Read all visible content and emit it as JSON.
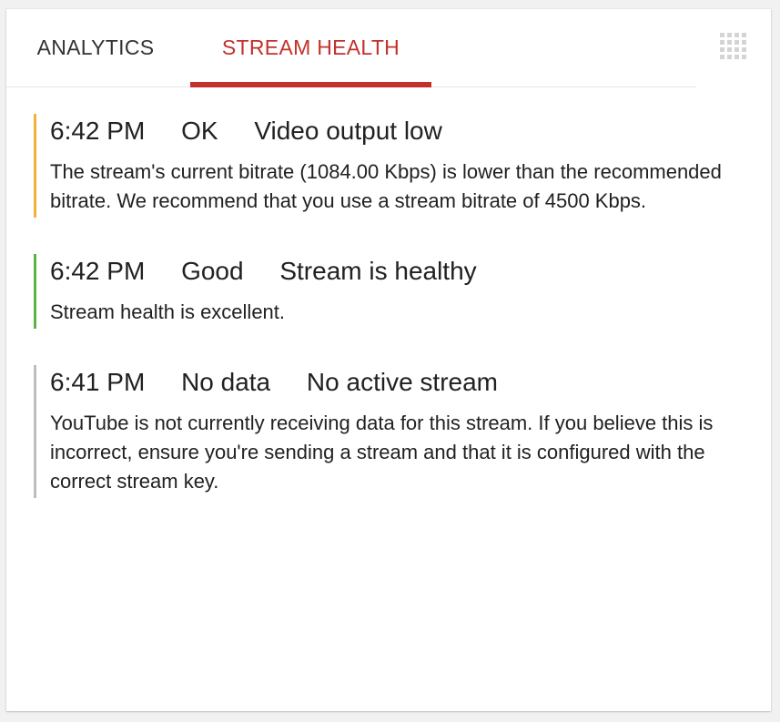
{
  "tabs": {
    "analytics": "ANALYTICS",
    "stream_health": "STREAM HEALTH",
    "active": "stream_health"
  },
  "colors": {
    "active_tab": "#c4302b",
    "ok": "#f0b33a",
    "good": "#5bb346",
    "no_data": "#bdbdbd"
  },
  "icons": {
    "menu": "grid-icon"
  },
  "events": [
    {
      "time": "6:42 PM",
      "status": "OK",
      "title": "Video output low",
      "description": "The stream's current bitrate (1084.00 Kbps) is lower than the recommended bitrate. We recommend that you use a stream bitrate of 4500 Kbps.",
      "color": "#f0b33a"
    },
    {
      "time": "6:42 PM",
      "status": "Good",
      "title": "Stream is healthy",
      "description": "Stream health is excellent.",
      "color": "#5bb346"
    },
    {
      "time": "6:41 PM",
      "status": "No data",
      "title": "No active stream",
      "description": "YouTube is not currently receiving data for this stream. If you believe this is incorrect, ensure you're sending a stream and that it is configured with the correct stream key.",
      "color": "#bdbdbd"
    }
  ]
}
